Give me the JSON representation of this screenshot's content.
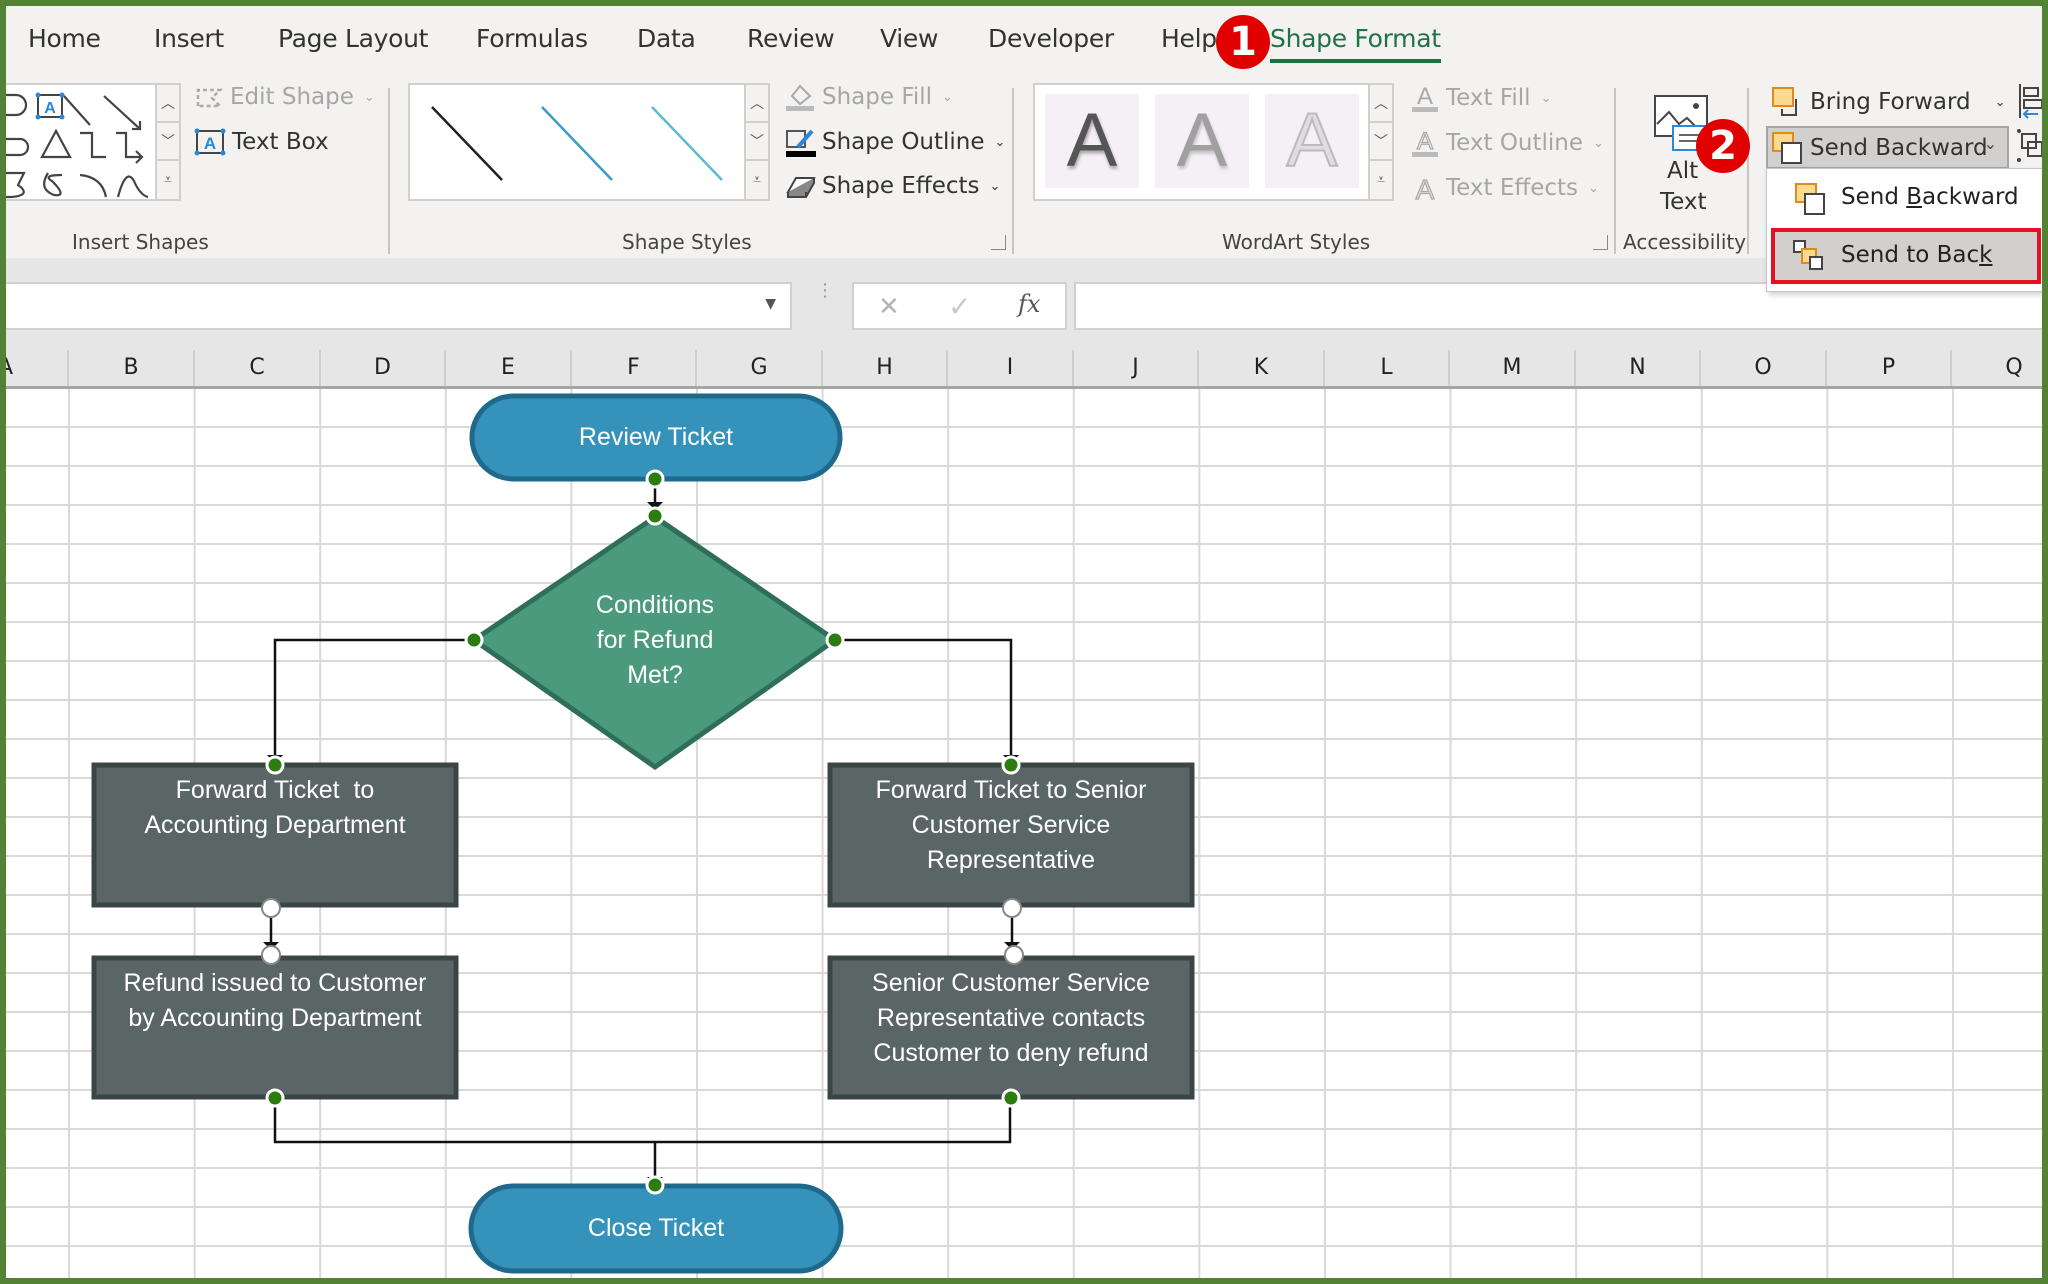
{
  "tabs": [
    {
      "label": "Home"
    },
    {
      "label": "Insert"
    },
    {
      "label": "Page Layout"
    },
    {
      "label": "Formulas"
    },
    {
      "label": "Data"
    },
    {
      "label": "Review"
    },
    {
      "label": "View"
    },
    {
      "label": "Developer"
    },
    {
      "label": "Help"
    },
    {
      "label": "Shape Format",
      "active": true
    }
  ],
  "ribbon": {
    "insert_shapes": {
      "label": "Insert Shapes",
      "edit_shape": "Edit Shape",
      "text_box": "Text Box"
    },
    "shape_styles": {
      "label": "Shape Styles",
      "shape_fill": "Shape Fill",
      "shape_outline": "Shape Outline",
      "shape_effects": "Shape Effects",
      "line_colors": [
        "#222222",
        "#3b9cc9",
        "#5bbcd0"
      ]
    },
    "wordart_styles": {
      "label": "WordArt Styles",
      "samples": [
        "A",
        "A",
        "A"
      ],
      "text_fill": "Text Fill",
      "text_outline": "Text Outline",
      "text_effects": "Text Effects"
    },
    "accessibility": {
      "label": "Accessibility",
      "alt_text_line1": "Alt",
      "alt_text_line2": "Text"
    },
    "arrange": {
      "bring_forward": "Bring Forward",
      "send_backward": "Send Backward"
    }
  },
  "dropdown": {
    "items": [
      {
        "label": "Send Backward",
        "underline_char": "B"
      },
      {
        "label": "Send to Back",
        "underline_char": "k",
        "highlighted": true
      }
    ]
  },
  "callouts": {
    "step1": "1",
    "step2": "2"
  },
  "formula_bar": {
    "name_box_value": "",
    "cancel_icon": "✕",
    "enter_icon": "✓",
    "fx_label": "fx",
    "formula_value": ""
  },
  "columns": [
    "A",
    "B",
    "C",
    "D",
    "E",
    "F",
    "G",
    "H",
    "I",
    "J",
    "K",
    "L",
    "M",
    "N",
    "O",
    "P",
    "Q"
  ],
  "flowchart": {
    "start": "Review Ticket",
    "decision": [
      "Conditions",
      "for Refund",
      "Met?"
    ],
    "left_step1": [
      "Forward Ticket  to",
      "Accounting Department"
    ],
    "left_step2": [
      "Refund issued to Customer",
      "by Accounting Department"
    ],
    "right_step1": [
      "Forward Ticket to Senior",
      "Customer Service",
      "Representative"
    ],
    "right_step2": [
      "Senior Customer Service",
      "Representative contacts",
      "Customer to deny refund"
    ],
    "end": "Close Ticket",
    "colors": {
      "terminator_fill": "#3592bb",
      "terminator_border": "#1f6a8c",
      "decision_fill": "#4b9a7e",
      "decision_border": "#2f6e58",
      "process_fill": "#5a6566",
      "process_border": "#3c4546",
      "handle_green": "#2b7d12"
    }
  },
  "colors": {
    "accent_green": "#217346",
    "frame_green": "#548235",
    "callout_red": "#e10000",
    "highlight_red": "#e81123"
  }
}
